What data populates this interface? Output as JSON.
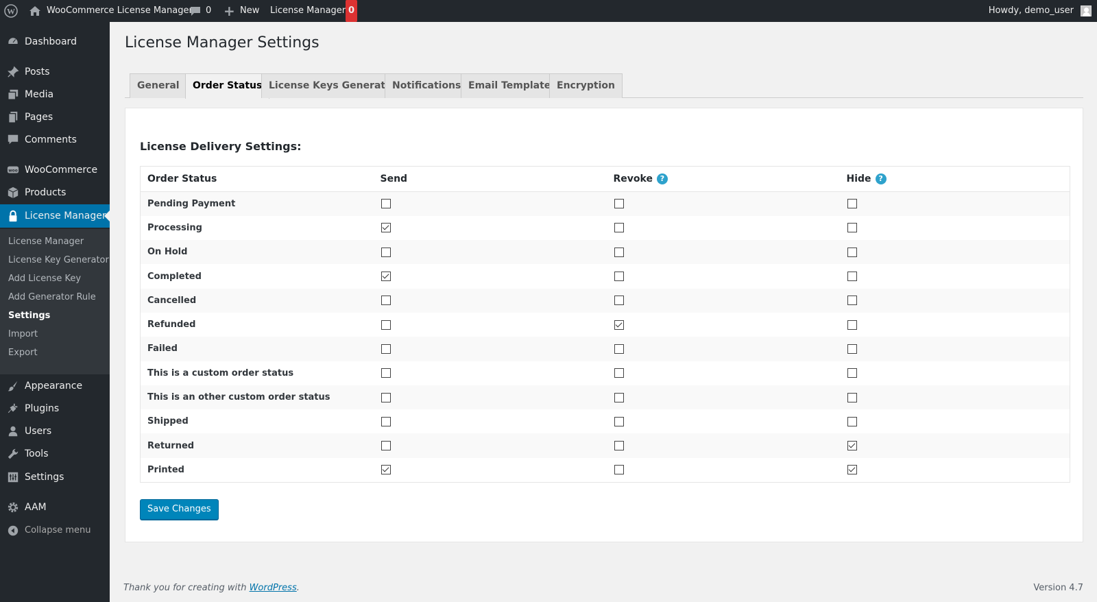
{
  "admin_bar": {
    "site_name": "WooCommerce License Manager",
    "comments_count": "0",
    "new_label": "New",
    "license_manager_label": "License Manager",
    "license_manager_badge": "0",
    "howdy": "Howdy, demo_user"
  },
  "sidebar": {
    "items": [
      {
        "label": "Dashboard",
        "icon": "dashboard-icon"
      },
      {
        "label": "Posts",
        "icon": "pin-icon"
      },
      {
        "label": "Media",
        "icon": "media-icon"
      },
      {
        "label": "Pages",
        "icon": "pages-icon"
      },
      {
        "label": "Comments",
        "icon": "comment-icon"
      },
      {
        "label": "WooCommerce",
        "icon": "woocommerce-icon"
      },
      {
        "label": "Products",
        "icon": "products-icon"
      },
      {
        "label": "License Manager",
        "icon": "lock-icon"
      },
      {
        "label": "Appearance",
        "icon": "brush-icon"
      },
      {
        "label": "Plugins",
        "icon": "plugin-icon"
      },
      {
        "label": "Users",
        "icon": "user-icon"
      },
      {
        "label": "Tools",
        "icon": "wrench-icon"
      },
      {
        "label": "Settings",
        "icon": "settings-icon"
      },
      {
        "label": "AAM",
        "icon": "gear-icon"
      },
      {
        "label": "Collapse menu",
        "icon": "collapse-icon"
      }
    ],
    "submenu": [
      "License Manager",
      "License Key Generator",
      "Add License Key",
      "Add Generator Rule",
      "Settings",
      "Import",
      "Export"
    ]
  },
  "page_title": "License Manager Settings",
  "tabs": [
    "General",
    "Order Status",
    "License Keys Generator",
    "Notifications",
    "Email Template",
    "Encryption"
  ],
  "active_tab": "Order Status",
  "section_title": "License Delivery Settings:",
  "table": {
    "headers": [
      "Order Status",
      "Send",
      "Revoke",
      "Hide"
    ],
    "rows": [
      {
        "status": "Pending Payment",
        "send": false,
        "revoke": false,
        "hide": false
      },
      {
        "status": "Processing",
        "send": true,
        "revoke": false,
        "hide": false
      },
      {
        "status": "On Hold",
        "send": false,
        "revoke": false,
        "hide": false
      },
      {
        "status": "Completed",
        "send": true,
        "revoke": false,
        "hide": false
      },
      {
        "status": "Cancelled",
        "send": false,
        "revoke": false,
        "hide": false
      },
      {
        "status": "Refunded",
        "send": false,
        "revoke": true,
        "hide": false
      },
      {
        "status": "Failed",
        "send": false,
        "revoke": false,
        "hide": false
      },
      {
        "status": "This is a custom order status",
        "send": false,
        "revoke": false,
        "hide": false
      },
      {
        "status": "This is an other custom order status",
        "send": false,
        "revoke": false,
        "hide": false
      },
      {
        "status": "Shipped",
        "send": false,
        "revoke": false,
        "hide": false
      },
      {
        "status": "Returned",
        "send": false,
        "revoke": false,
        "hide": true
      },
      {
        "status": "Printed",
        "send": true,
        "revoke": false,
        "hide": true
      }
    ]
  },
  "save_button": "Save Changes",
  "footer": {
    "thank_you_prefix": "Thank you for creating with ",
    "wordpress_link": "WordPress",
    "thank_you_suffix": ".",
    "version": "Version 4.7"
  },
  "colors": {
    "admin_bar": "#23282d",
    "sidebar": "#23282d",
    "submenu": "#32373c",
    "accent": "#0073aa",
    "primary_button": "#0085ba",
    "help_icon": "#2ea2cc",
    "badge": "#dc3232"
  }
}
